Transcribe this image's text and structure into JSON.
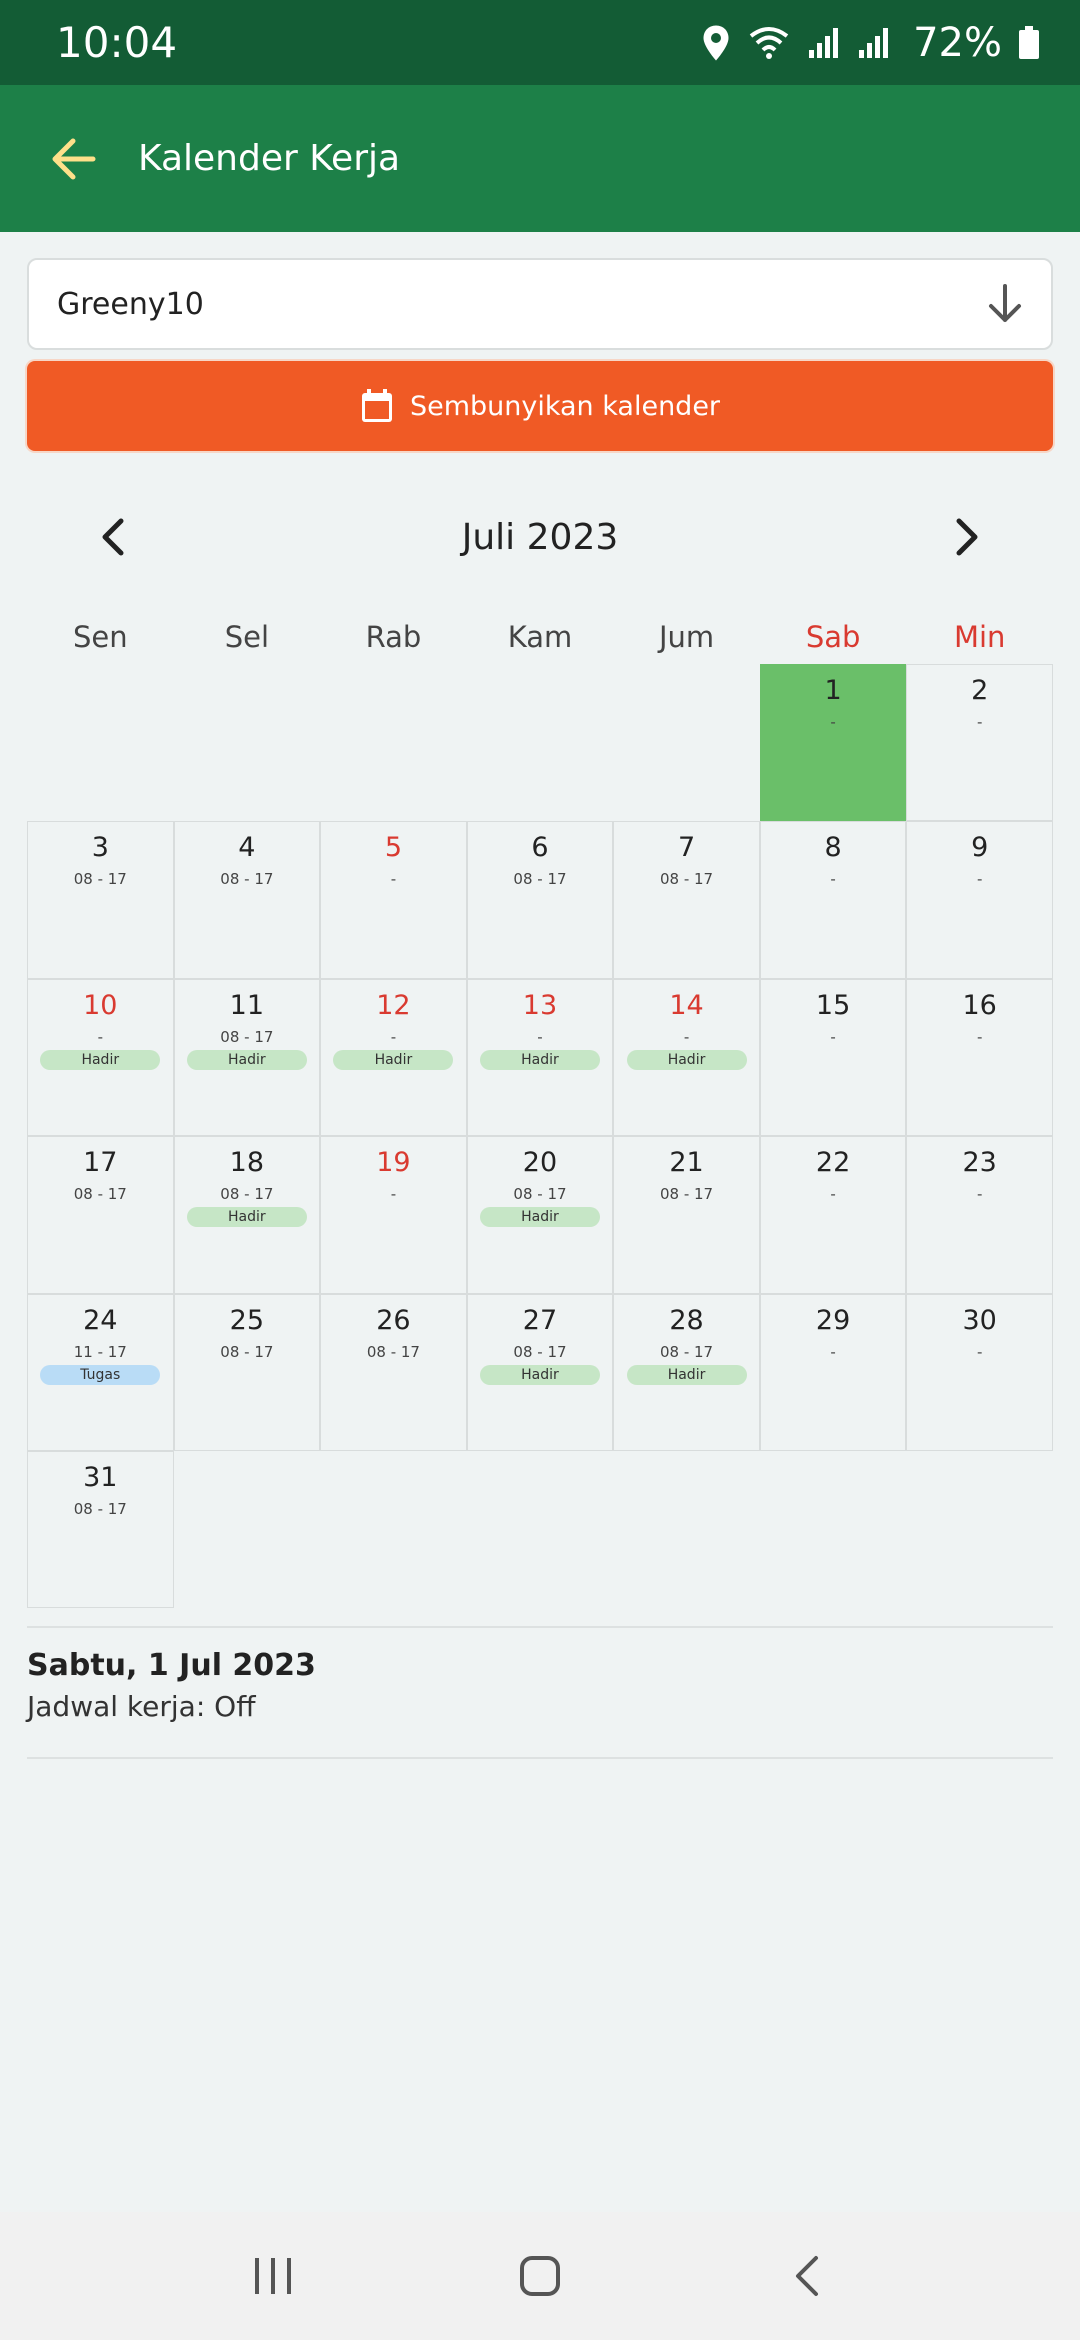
{
  "status_bar": {
    "time": "10:04",
    "battery": "72%"
  },
  "app_bar": {
    "title": "Kalender Kerja"
  },
  "dropdown": {
    "value": "Greeny10"
  },
  "toggle_button": {
    "label": "Sembunyikan kalender"
  },
  "calendar": {
    "month_title": "Juli 2023",
    "weekdays": [
      "Sen",
      "Sel",
      "Rab",
      "Kam",
      "Jum",
      "Sab",
      "Min"
    ],
    "weekend_color": "#d93a30",
    "selected_color": "#6abf69",
    "days": [
      {
        "n": "1",
        "shift": "-",
        "badge": "",
        "red": false,
        "selected": true
      },
      {
        "n": "2",
        "shift": "-",
        "badge": "",
        "red": false
      },
      {
        "n": "3",
        "shift": "08 - 17",
        "badge": "",
        "red": false
      },
      {
        "n": "4",
        "shift": "08 - 17",
        "badge": "",
        "red": false
      },
      {
        "n": "5",
        "shift": "-",
        "badge": "",
        "red": true
      },
      {
        "n": "6",
        "shift": "08 - 17",
        "badge": "",
        "red": false
      },
      {
        "n": "7",
        "shift": "08 - 17",
        "badge": "",
        "red": false
      },
      {
        "n": "8",
        "shift": "-",
        "badge": "",
        "red": false
      },
      {
        "n": "9",
        "shift": "-",
        "badge": "",
        "red": false
      },
      {
        "n": "10",
        "shift": "-",
        "badge": "Hadir",
        "red": true
      },
      {
        "n": "11",
        "shift": "08 - 17",
        "badge": "Hadir",
        "red": false
      },
      {
        "n": "12",
        "shift": "-",
        "badge": "Hadir",
        "red": true
      },
      {
        "n": "13",
        "shift": "-",
        "badge": "Hadir",
        "red": true
      },
      {
        "n": "14",
        "shift": "-",
        "badge": "Hadir",
        "red": true
      },
      {
        "n": "15",
        "shift": "-",
        "badge": "",
        "red": false
      },
      {
        "n": "16",
        "shift": "-",
        "badge": "",
        "red": false
      },
      {
        "n": "17",
        "shift": "08 - 17",
        "badge": "",
        "red": false
      },
      {
        "n": "18",
        "shift": "08 - 17",
        "badge": "Hadir",
        "red": false
      },
      {
        "n": "19",
        "shift": "-",
        "badge": "",
        "red": true
      },
      {
        "n": "20",
        "shift": "08 - 17",
        "badge": "Hadir",
        "red": false
      },
      {
        "n": "21",
        "shift": "08 - 17",
        "badge": "",
        "red": false
      },
      {
        "n": "22",
        "shift": "-",
        "badge": "",
        "red": false
      },
      {
        "n": "23",
        "shift": "-",
        "badge": "",
        "red": false
      },
      {
        "n": "24",
        "shift": "11 - 17",
        "badge": "Tugas",
        "red": false
      },
      {
        "n": "25",
        "shift": "08 - 17",
        "badge": "",
        "red": false
      },
      {
        "n": "26",
        "shift": "08 - 17",
        "badge": "",
        "red": false
      },
      {
        "n": "27",
        "shift": "08 - 17",
        "badge": "Hadir",
        "red": false
      },
      {
        "n": "28",
        "shift": "08 - 17",
        "badge": "Hadir",
        "red": false
      },
      {
        "n": "29",
        "shift": "-",
        "badge": "",
        "red": false
      },
      {
        "n": "30",
        "shift": "-",
        "badge": "",
        "red": false
      },
      {
        "n": "31",
        "shift": "08 - 17",
        "badge": "",
        "red": false
      }
    ]
  },
  "detail": {
    "date": "Sabtu, 1 Jul 2023",
    "schedule": "Jadwal kerja: Off"
  },
  "colors": {
    "status_bar": "#135c35",
    "app_bar": "#1d8048",
    "toggle_button": "#f05a25",
    "back_arrow": "#ffe08a",
    "hadir_badge": "#c6e6c6",
    "tugas_badge": "#b9dcf6"
  }
}
